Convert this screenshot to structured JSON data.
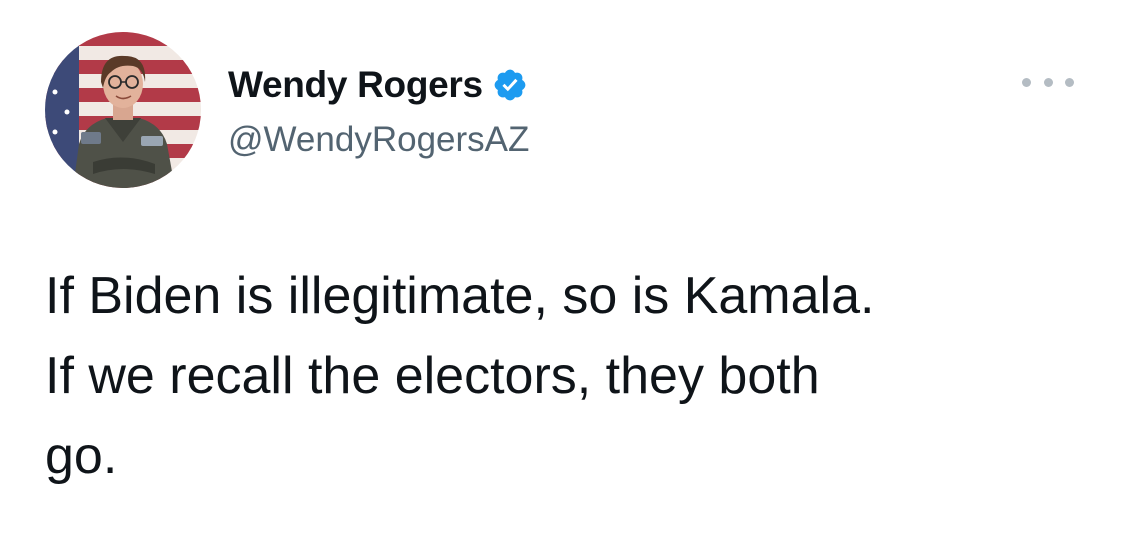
{
  "tweet": {
    "author": {
      "display_name": "Wendy Rogers",
      "handle": "@WendyRogersAZ",
      "verified": true,
      "verified_icon": "verified-badge-icon",
      "avatar_icon": "profile-photo"
    },
    "more_icon": "more-options-icon",
    "text_lines": [
      "If Biden is illegitimate, so is Kamala.",
      "If we recall the electors, they both",
      "go."
    ]
  },
  "colors": {
    "text": "#0f1419",
    "secondary_text": "#536471",
    "verified_blue": "#1d9bf0",
    "more_dots": "#b4bcc3",
    "background": "#ffffff"
  }
}
